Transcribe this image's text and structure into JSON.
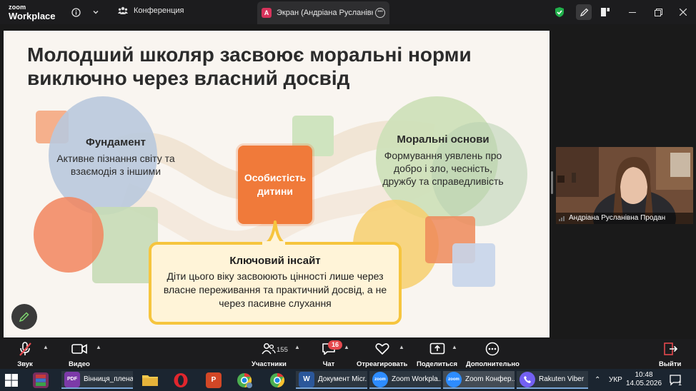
{
  "app": {
    "logo_line1": "zoom",
    "logo_line2": "Workplace",
    "meeting_label": "Конференция",
    "share_tab_letter": "A",
    "share_tab_title": "Экран (Андріана Русланівна Прод"
  },
  "slide": {
    "title": "Молодший школяр засвоює моральні норми виключно через власний досвід",
    "left_heading": "Фундамент",
    "left_body": "Активне пізнання світу та взаємодія з іншими",
    "center_label": "Особистість дитини",
    "right_heading": "Моральні основи",
    "right_body": "Формування уявлень про добро і зло, чесність, дружбу та справедливість",
    "insight_heading": "Ключовий інсайт",
    "insight_body": "Діти цього віку засвоюють цінності лише через власне переживання та практичний досвід, а не через пасивне слухання"
  },
  "participant": {
    "name": "Андріана Русланівна Продан"
  },
  "toolbar": {
    "audio": "Звук",
    "video": "Видео",
    "participants": "Участники",
    "participants_count": "155",
    "chat": "Чат",
    "chat_badge": "16",
    "react": "Отреагировать",
    "share": "Поделиться",
    "more": "Дополнительно",
    "leave": "Выйти"
  },
  "taskbar": {
    "pdf_app": "Вінниця_плена...",
    "word_doc": "Документ Micr...",
    "zoom_workplace": "Zoom Workpla...",
    "zoom_meeting": "Zoom Конфер...",
    "viber": "Rakuten Viber",
    "lang": "УКР",
    "time": "10:48",
    "date": "14.05.2026",
    "notif_count": "1"
  },
  "colors": {
    "accent_orange": "#f07a3a",
    "insight_border": "#f6c53e",
    "leave_red": "#e5484d",
    "shield_green": "#21b04b"
  }
}
